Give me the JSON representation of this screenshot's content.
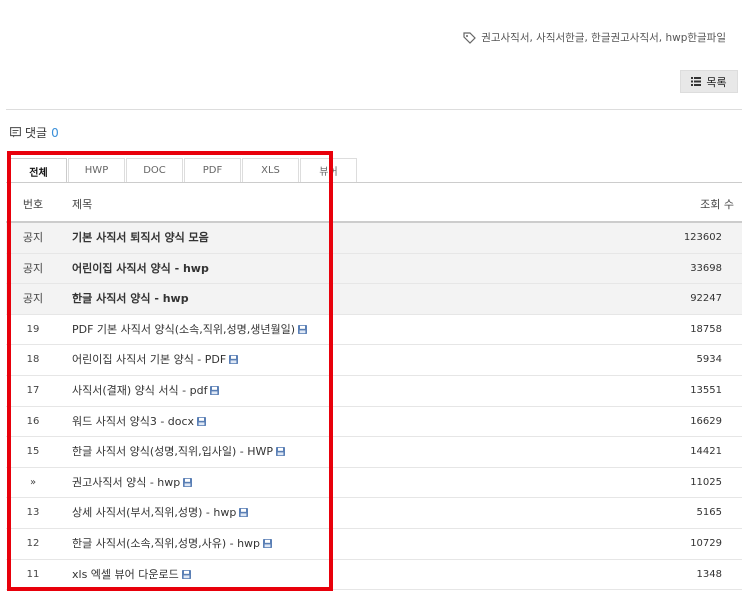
{
  "tags": "권고사직서, 사직서한글, 한글권고사직서, hwp한글파일",
  "list_button": "목록",
  "comments": {
    "label": "댓글",
    "count": "0"
  },
  "tabs": [
    {
      "label": "전체",
      "active": true
    },
    {
      "label": "HWP"
    },
    {
      "label": "DOC"
    },
    {
      "label": "PDF"
    },
    {
      "label": "XLS"
    },
    {
      "label": "뷰어"
    }
  ],
  "table": {
    "headers": {
      "num": "번호",
      "title": "제목",
      "views": "조회 수"
    },
    "rows": [
      {
        "num": "공지",
        "title": "기본 사직서 퇴직서 양식 모음",
        "views": "123602",
        "notice": true
      },
      {
        "num": "공지",
        "title": "어린이집 사직서 양식 - hwp",
        "views": "33698",
        "notice": true
      },
      {
        "num": "공지",
        "title": "한글 사직서 양식 - hwp",
        "views": "92247",
        "notice": true
      },
      {
        "num": "19",
        "title": "PDF 기본 사직서 양식(소속,직위,성명,생년월일)",
        "views": "18758",
        "file": true
      },
      {
        "num": "18",
        "title": "어린이집 사직서 기본 양식 - PDF",
        "views": "5934",
        "file": true
      },
      {
        "num": "17",
        "title": "사직서(결재) 양식 서식 - pdf",
        "views": "13551",
        "file": true
      },
      {
        "num": "16",
        "title": "워드 사직서 양식3 - docx",
        "views": "16629",
        "file": true
      },
      {
        "num": "15",
        "title": "한글 사직서 양식(성명,직위,입사일) - HWP",
        "views": "14421",
        "file": true
      },
      {
        "num": "»",
        "title": "권고사직서 양식 - hwp",
        "views": "11025",
        "file": true
      },
      {
        "num": "13",
        "title": "상세 사직서(부서,직위,성명) - hwp",
        "views": "5165",
        "file": true
      },
      {
        "num": "12",
        "title": "한글 사직서(소속,직위,성명,사유) - hwp",
        "views": "10729",
        "file": true
      },
      {
        "num": "11",
        "title": "xls 엑셀 뷰어 다운로드",
        "views": "1348",
        "file": true
      }
    ]
  }
}
